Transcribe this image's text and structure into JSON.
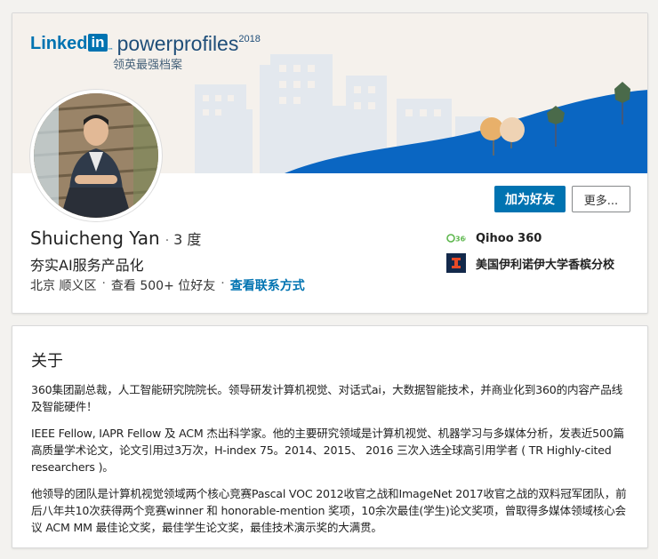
{
  "banner": {
    "logo_linked": "Linked",
    "logo_in": "in",
    "logo_tm": "™",
    "product": "powerprofiles",
    "year": "2018",
    "subtitle": "领英最强档案"
  },
  "profile": {
    "name": "Shuicheng Yan",
    "separator": "·",
    "degree": "3 度",
    "headline": "夯实AI服务产品化",
    "location": "北京 顺义区",
    "connections": "查看 500+ 位好友",
    "contact_link": "查看联系方式",
    "connect_button": "加为好友",
    "more_button": "更多...",
    "company": "Qihoo 360",
    "school": "美国伊利诺伊大学香槟分校"
  },
  "about": {
    "title": "关于",
    "paragraphs": [
      "360集团副总裁，人工智能研究院院长。领导研发计算机视觉、对话式ai，大数据智能技术，并商业化到360的内容产品线及智能硬件！",
      "IEEE Fellow, IAPR Fellow 及 ACM 杰出科学家。他的主要研究领域是计算机视觉、机器学习与多媒体分析，发表近500篇高质量学术论文，论文引用过3万次，H-index 75。2014、2015、 2016 三次入选全球高引用学者 ( TR Highly-cited researchers )。",
      "他领导的团队是计算机视觉领域两个核心竞赛Pascal VOC 2012收官之战和ImageNet 2017收官之战的双料冠军团队，前后八年共10次获得两个竞赛winner 和 honorable-mention 奖项，10余次最佳(学生)论文奖项，曾取得多媒体领域核心会议 ACM MM 最佳论文奖，最佳学生论文奖，最佳技术演示奖的大满贯。"
    ]
  },
  "colors": {
    "linkedin_blue": "#0073b1",
    "banner_bg": "#f5f1ec",
    "hill_blue": "#0a66c2",
    "tree_green": "#4a6a4a",
    "tree_orange": "#e8b06a",
    "logo_360_green": "#5db74d",
    "illinois_navy": "#13294b",
    "illinois_orange": "#e84a27"
  },
  "icons": [
    "linkedin-logo",
    "qihoo-360-logo",
    "illinois-logo"
  ]
}
